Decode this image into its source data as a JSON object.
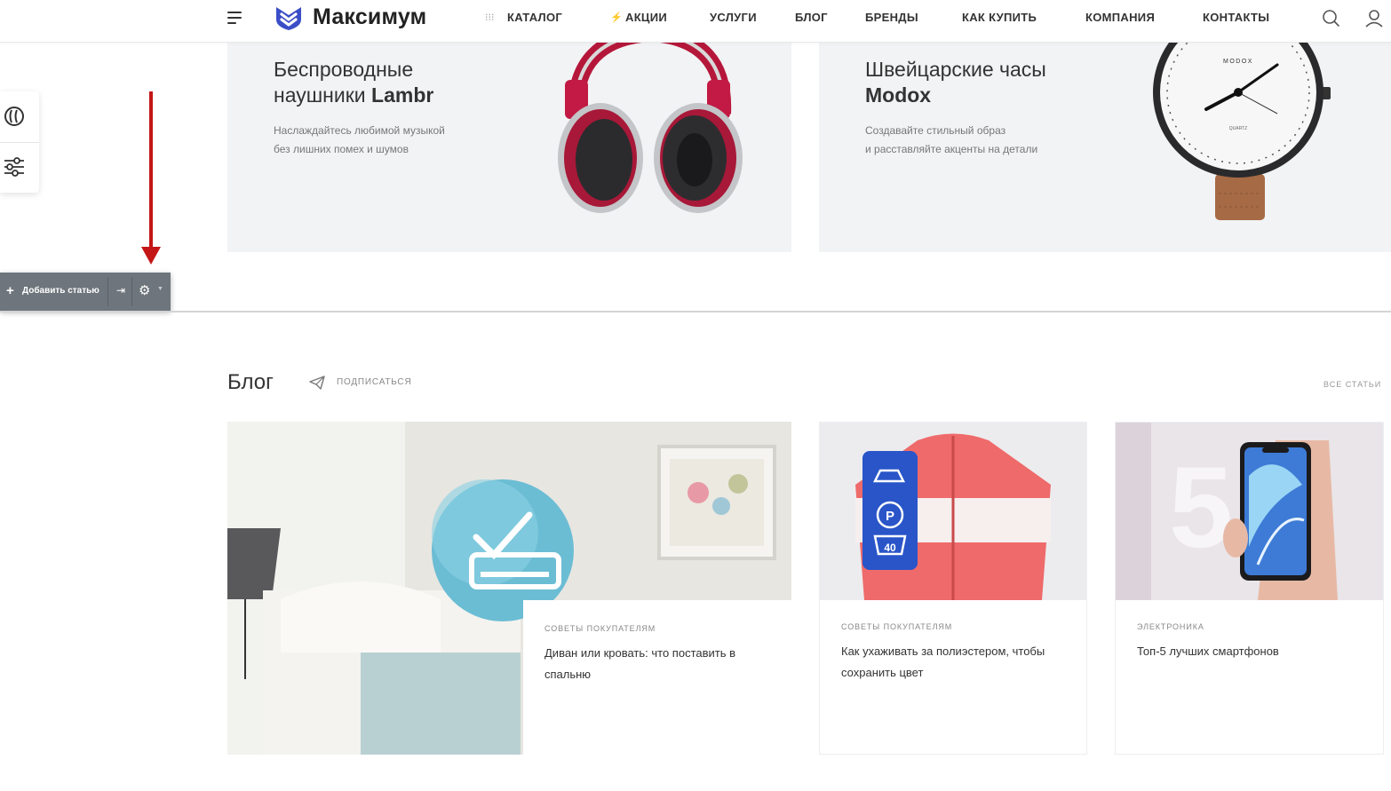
{
  "header": {
    "logo_text": "Максимум",
    "nav": [
      {
        "label": "КАТАЛОГ"
      },
      {
        "label": "АКЦИИ"
      },
      {
        "label": "УСЛУГИ"
      },
      {
        "label": "БЛОГ"
      },
      {
        "label": "БРЕНДЫ"
      },
      {
        "label": "КАК КУПИТЬ"
      },
      {
        "label": "КОМПАНИЯ"
      },
      {
        "label": "КОНТАКТЫ"
      }
    ],
    "icons": [
      "menu-icon",
      "grid-dots-icon",
      "lightning-icon",
      "search-icon",
      "user-icon"
    ]
  },
  "editor": {
    "add_article_label": "Добавить статью",
    "icons": [
      "plus-icon",
      "pin-icon",
      "gear-icon",
      "chevron-down-icon",
      "theme-icon",
      "sliders-icon"
    ],
    "arrow_color": "#c41616"
  },
  "promos": [
    {
      "title_line1": "Беспроводные",
      "title_line2_prefix": "наушники ",
      "title_line2_bold": "Lambr",
      "desc_line1": "Наслаждайтесь любимой музыкой",
      "desc_line2": "без лишних помех и шумов"
    },
    {
      "title_line1": "Швейцарские часы",
      "title_line2_bold": "Modox",
      "desc_line1": "Создавайте стильный образ",
      "desc_line2": "и расставляйте акценты на детали",
      "watch_brand": "MODOX",
      "watch_sub": "QUARTZ"
    }
  ],
  "blog": {
    "title": "Блог",
    "subscribe_label": "ПОДПИСАТЬСЯ",
    "all_label": "ВСЕ СТАТЬИ",
    "cards": [
      {
        "category": "СОВЕТЫ ПОКУПАТЕЛЯМ",
        "title": "Диван или кровать: что поставить в спальню"
      },
      {
        "category": "СОВЕТЫ ПОКУПАТЕЛЯМ",
        "title": "Как ухаживать за полиэстером, чтобы сохранить цвет",
        "tag_number": "40"
      },
      {
        "category": "ЭЛЕКТРОНИКА",
        "title": "Топ-5 лучших смартфонов",
        "big_number": "5"
      }
    ]
  },
  "colors": {
    "brand": "#3b4ec8",
    "banner_bg": "#f2f3f5",
    "toolbar_bg": "#6e757c"
  }
}
